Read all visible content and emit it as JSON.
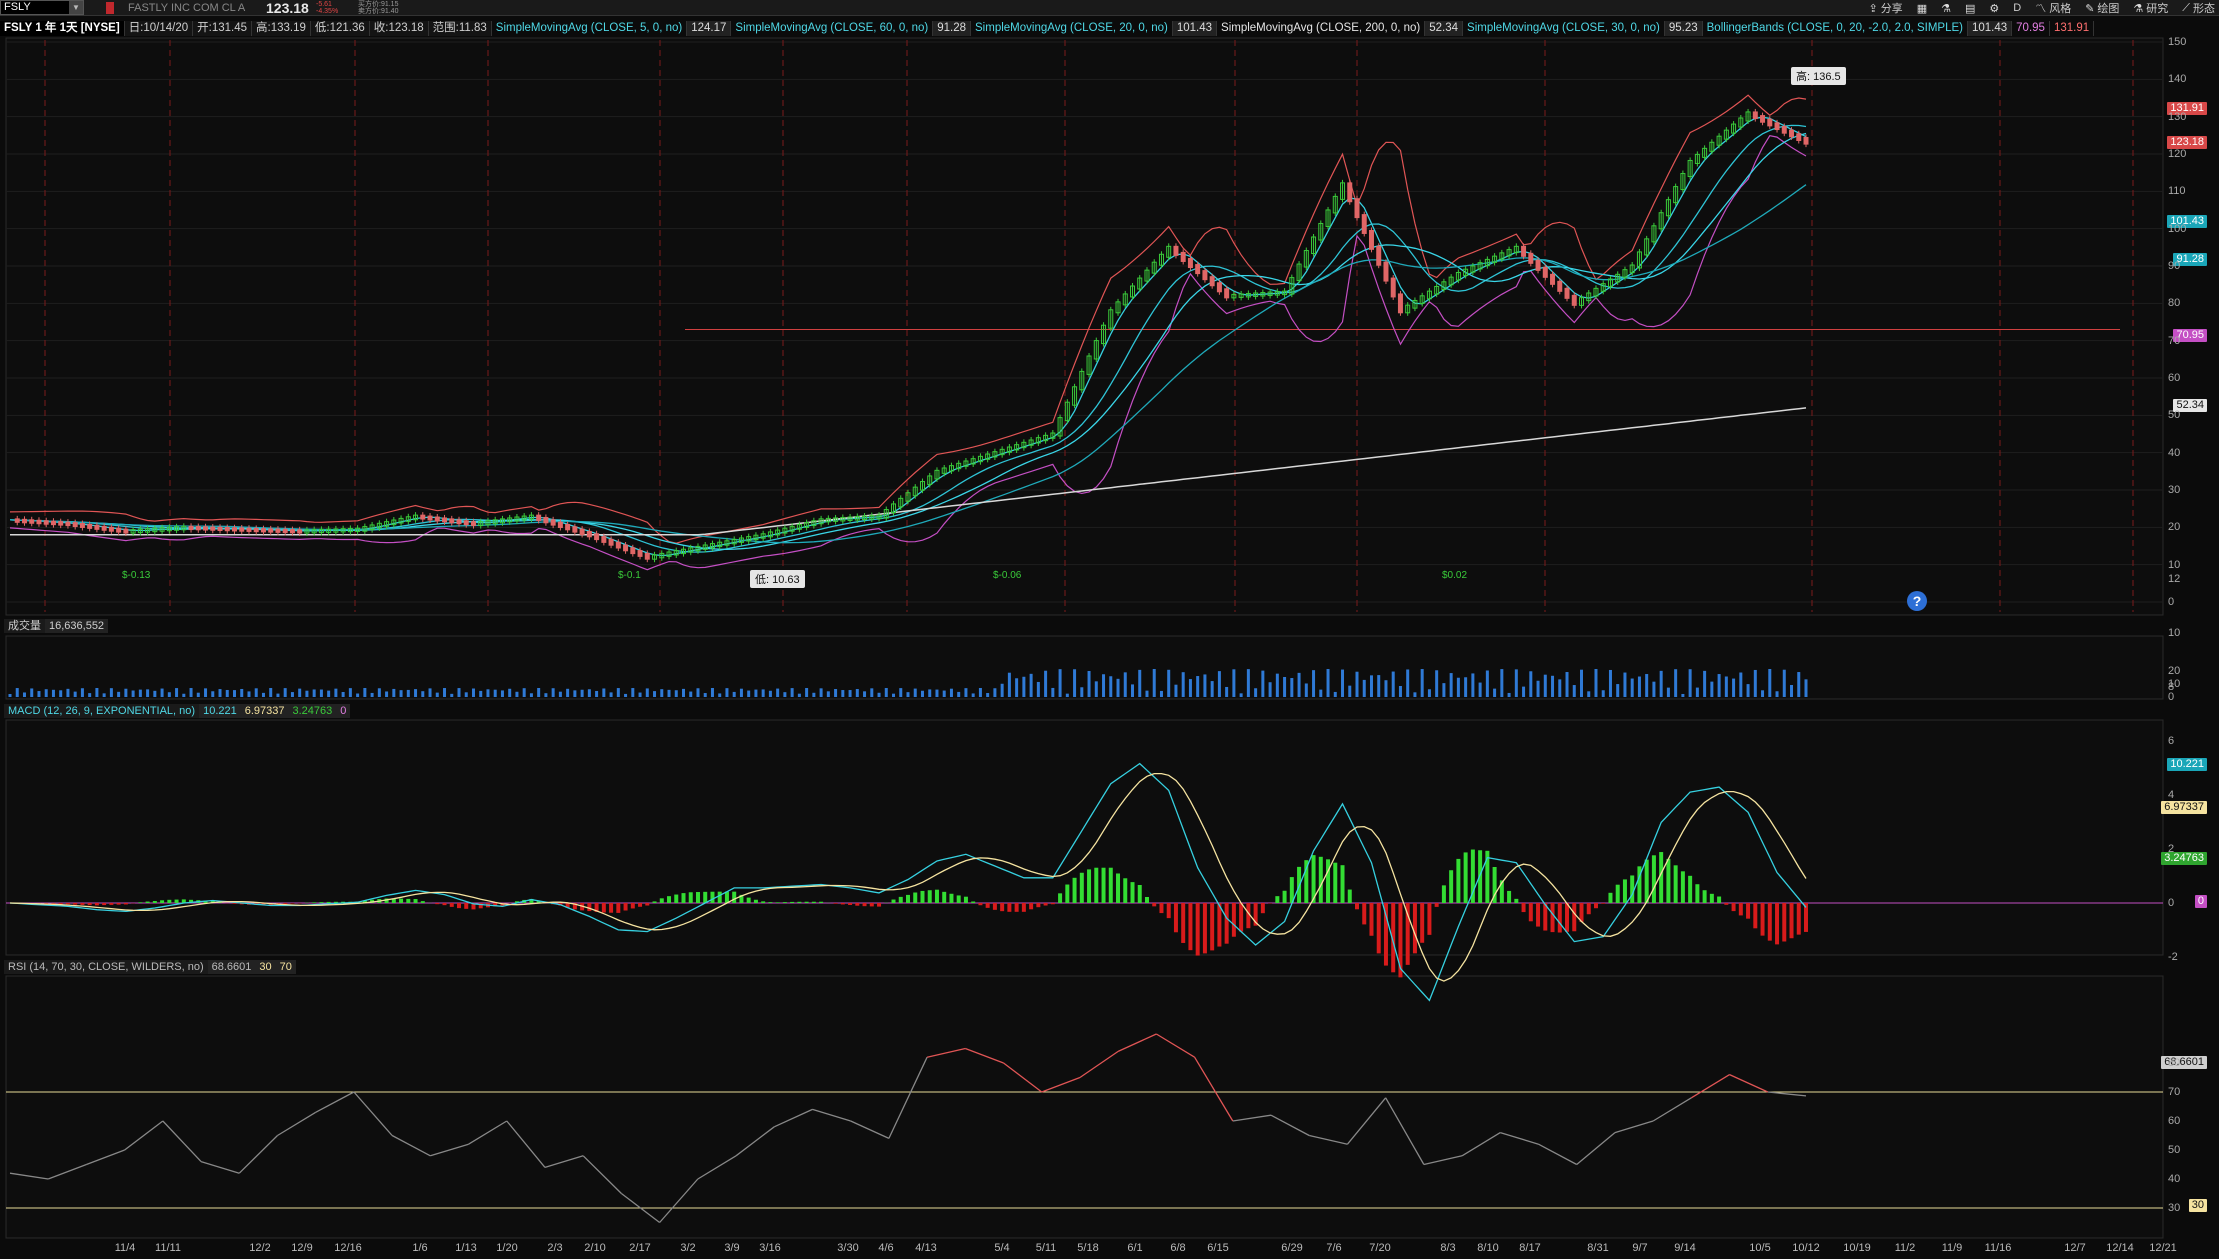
{
  "header": {
    "symbol": "FSLY",
    "company": "FASTLY INC COM CL A",
    "last": "123.18",
    "change": "-5.61",
    "change_pct": "-4.35%",
    "bid": "买方价:91.15",
    "ask": "卖方价:91.40"
  },
  "toolbar": {
    "share": "分享",
    "period": "D",
    "style": "风格",
    "drawing": "绘图",
    "studies": "研究",
    "patterns": "形态"
  },
  "info": {
    "title": "FSLY 1 年 1天 [NYSE]",
    "date": "日:10/14/20",
    "open": "开:131.45",
    "high": "高:133.19",
    "low": "低:121.36",
    "close": "收:123.18",
    "range": "范围:11.83",
    "studies": [
      {
        "label": "SimpleMovingAvg (CLOSE, 5, 0, no)",
        "value": "124.17"
      },
      {
        "label": "SimpleMovingAvg (CLOSE, 60, 0, no)",
        "value": "91.28"
      },
      {
        "label": "SimpleMovingAvg (CLOSE, 20, 0, no)",
        "value": "101.43"
      },
      {
        "label": "SimpleMovingAvg (CLOSE, 200, 0, no)",
        "value": "52.34"
      },
      {
        "label": "SimpleMovingAvg (CLOSE, 30, 0, no)",
        "value": "95.23"
      }
    ],
    "bb_label": "BollingerBands (CLOSE, 0, 20, -2.0, 2.0, SIMPLE)",
    "bb_values": [
      "101.43",
      "70.95",
      "131.91"
    ]
  },
  "volume_panel": {
    "label": "成交量",
    "value": "16,636,552"
  },
  "macd_panel": {
    "label": "MACD (12, 26, 9, EXPONENTIAL, no)",
    "values": [
      "10.221",
      "6.97337",
      "3.24763",
      "0"
    ]
  },
  "rsi_panel": {
    "label": "RSI (14, 70, 30, CLOSE, WILDERS, no)",
    "values": [
      "68.6601",
      "30",
      "70"
    ]
  },
  "callouts": {
    "high": "高: 136.5",
    "low": "低: 10.63"
  },
  "price_tags": [
    "131.91",
    "123.18",
    "101.43",
    "91.28",
    "70.95",
    "52.34"
  ],
  "macd_tags": [
    "10.221",
    "6.97337",
    "3.24763",
    "0"
  ],
  "rsi_tag": "68.6601",
  "rsi_lines": [
    "30"
  ],
  "dividend_labels": [
    "$-0.13",
    "$-0.1",
    "$-0.06",
    "$0.02"
  ],
  "help": "?",
  "chart_data": {
    "type": "candlestick",
    "x_ticks": [
      "11/4",
      "11/11",
      "12/2",
      "12/9",
      "12/16",
      "1/6",
      "1/13",
      "1/20",
      "2/3",
      "2/10",
      "2/17",
      "3/2",
      "3/9",
      "3/16",
      "3/30",
      "4/6",
      "4/13",
      "5/4",
      "5/11",
      "5/18",
      "6/1",
      "6/8",
      "6/15",
      "6/29",
      "7/6",
      "7/20",
      "8/3",
      "8/10",
      "8/17",
      "8/31",
      "9/7",
      "9/14",
      "10/5",
      "10/12",
      "10/19",
      "11/2",
      "11/9",
      "11/16",
      "12/7",
      "12/14",
      "12/21"
    ],
    "price_axis": [
      0,
      10,
      20,
      30,
      40,
      50,
      60,
      70,
      80,
      90,
      100,
      110,
      120,
      130,
      140,
      150
    ],
    "price_ylim": [
      0,
      150
    ],
    "volume_axis": [
      0,
      10,
      20
    ],
    "macd_axis": [
      -2,
      0,
      2,
      4,
      6,
      8,
      10,
      12
    ],
    "rsi_axis": [
      30,
      40,
      50,
      60,
      70,
      80
    ],
    "horizontal_line": 73,
    "close_series": [
      {
        "d": "10/14/19",
        "v": 22
      },
      {
        "d": "10/28/19",
        "v": 21
      },
      {
        "d": "11/11/19",
        "v": 19
      },
      {
        "d": "11/25/19",
        "v": 20
      },
      {
        "d": "12/9/19",
        "v": 19.5
      },
      {
        "d": "12/23/19",
        "v": 19
      },
      {
        "d": "1/6/20",
        "v": 19.5
      },
      {
        "d": "1/20/20",
        "v": 23
      },
      {
        "d": "2/3/20",
        "v": 21
      },
      {
        "d": "2/17/20",
        "v": 23
      },
      {
        "d": "3/2/20",
        "v": 18
      },
      {
        "d": "3/16/20",
        "v": 12
      },
      {
        "d": "3/23/20",
        "v": 15
      },
      {
        "d": "4/6/20",
        "v": 18
      },
      {
        "d": "4/20/20",
        "v": 22
      },
      {
        "d": "5/4/20",
        "v": 23
      },
      {
        "d": "5/11/20",
        "v": 35
      },
      {
        "d": "5/25/20",
        "v": 40
      },
      {
        "d": "6/8/20",
        "v": 45
      },
      {
        "d": "6/22/20",
        "v": 78
      },
      {
        "d": "7/6/20",
        "v": 95
      },
      {
        "d": "7/13/20",
        "v": 82
      },
      {
        "d": "7/27/20",
        "v": 83
      },
      {
        "d": "8/3/20",
        "v": 112
      },
      {
        "d": "8/10/20",
        "v": 78
      },
      {
        "d": "8/24/20",
        "v": 88
      },
      {
        "d": "9/1/20",
        "v": 95
      },
      {
        "d": "9/8/20",
        "v": 80
      },
      {
        "d": "9/21/20",
        "v": 90
      },
      {
        "d": "10/5/20",
        "v": 118
      },
      {
        "d": "10/9/20",
        "v": 131
      },
      {
        "d": "10/14/20",
        "v": 123.18
      }
    ],
    "rsi_series": [
      42,
      40,
      45,
      50,
      60,
      46,
      42,
      55,
      63,
      70,
      55,
      48,
      52,
      60,
      44,
      48,
      35,
      25,
      40,
      48,
      58,
      64,
      60,
      54,
      82,
      85,
      80,
      70,
      75,
      84,
      90,
      82,
      60,
      62,
      55,
      52,
      68,
      45,
      48,
      56,
      52,
      45,
      56,
      60,
      68,
      76,
      70,
      68.66
    ]
  }
}
